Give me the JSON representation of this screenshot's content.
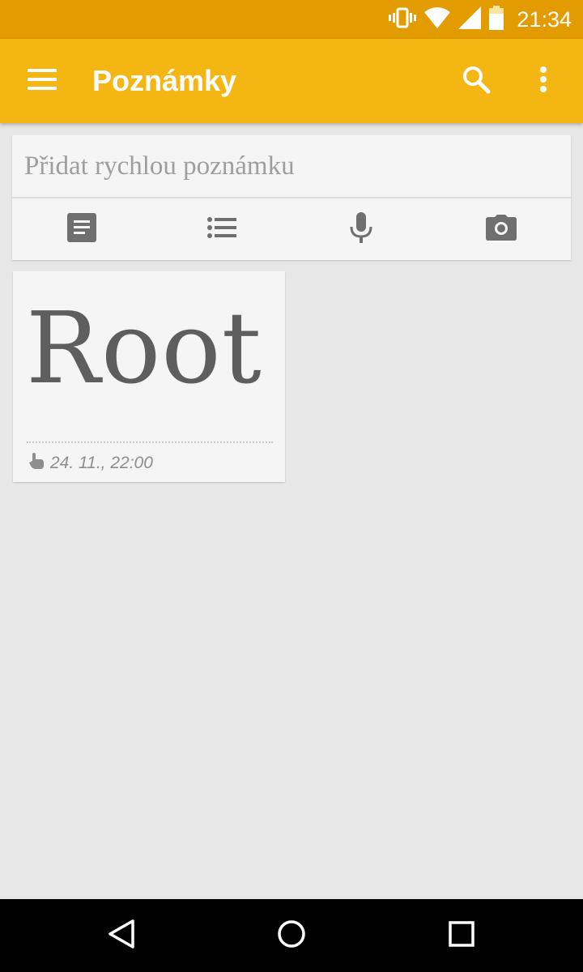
{
  "status_bar": {
    "time": "21:34",
    "icons": [
      "vibrate-icon",
      "wifi-icon",
      "signal-icon",
      "battery-icon"
    ]
  },
  "app_bar": {
    "title": "Poznámky",
    "background": "#f4b612",
    "icons": [
      "menu-icon",
      "search-icon",
      "more-vert-icon"
    ]
  },
  "quick_note": {
    "placeholder": "Přidat rychlou poznámku",
    "actions": [
      "note-icon",
      "list-icon",
      "mic-icon",
      "camera-icon"
    ]
  },
  "notes": [
    {
      "title": "Root",
      "timestamp": "24. 11., 22:00"
    }
  ],
  "nav_bar": {
    "buttons": [
      "back-icon",
      "home-icon",
      "recents-icon"
    ]
  }
}
